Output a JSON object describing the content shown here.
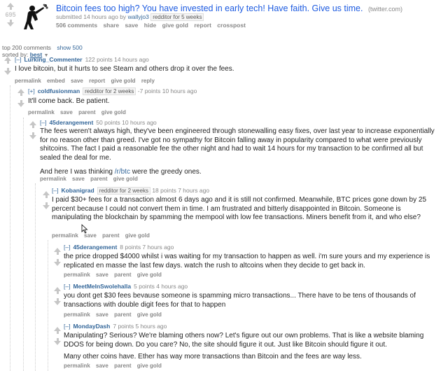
{
  "post": {
    "score": "695",
    "title": "Bitcoin fees too high? You have invested in early tech! Have faith. Give us time.",
    "domain": "(twitter.com)",
    "submitted_prefix": "submitted 14 hours ago by",
    "author": "wallyjo3",
    "flair": "redditor for 5 weeks",
    "buttons": [
      "506 comments",
      "share",
      "save",
      "hide",
      "give gold",
      "report",
      "crosspost"
    ]
  },
  "comments_info": {
    "count_text": "top 200 comments",
    "show_all": "show 500",
    "sorted_by": "sorted by:",
    "sort": "best"
  },
  "comments": [
    {
      "toggle": "[–]",
      "author": "Lurking_Commenter",
      "meta": "122 points 14 hours ago",
      "flair": "",
      "body": [
        "I love bitcoin, but it hurts to see Steam and others drop it over the fees."
      ],
      "buttons": [
        "permalink",
        "embed",
        "save",
        "report",
        "give gold",
        "reply"
      ]
    },
    {
      "toggle": "[+]",
      "author": "coldfusionman",
      "flair": "redditor for 2 weeks",
      "meta": "-7 points 10 hours ago",
      "body": [
        "It'll come back. Be patient."
      ],
      "buttons": [
        "permalink",
        "save",
        "parent",
        "give gold"
      ]
    },
    {
      "toggle": "[–]",
      "author": "45derangement",
      "meta": "50 points 10 hours ago",
      "flair": "",
      "body": [
        "The fees weren't always high, they've been engineered through stonewalling easy fixes, over last year to increase exponentially for no reason other than greed. I've got no sympathy for Bitcoin falling away in popularity compared to what were previously shitcoins. The fact I paid a reasonable fee the other night and had to wait 14 hours for my transaction to be confirmed all but sealed the deal for me.",
        "And here I was thinking "
      ],
      "link": "/r/btc",
      "link_suffix": " were the greedy ones.",
      "buttons": [
        "permalink",
        "save",
        "parent",
        "give gold"
      ]
    },
    {
      "toggle": "[–]",
      "author": "Kobanigrad",
      "flair": "redditor for 2 weeks",
      "meta": "18 points 7 hours ago",
      "body": [
        "I paid $30+ fees for a transaction almost 6 days ago and it is still not confirmed. Meanwhile, BTC prices gone down by 25 percent because I could not convert them in time. I am frustrated and bitterly disappointed in Bitcoin. Someone is manipulating the blockchain by spamming the mempool with low fee transactions. Miners benefit from it, and who else?"
      ],
      "buttons": [
        "permalink",
        "save",
        "parent",
        "give gold"
      ]
    },
    {
      "toggle": "[–]",
      "author": "45derangement",
      "meta": "8 points 7 hours ago",
      "flair": "",
      "body": [
        "the price dropped $4000 whilst i was waiting for my transaction to happen as well. i'm sure yours and my experience is replicated en masse the last few days. watch the rush to altcoins when they decide to get back in."
      ],
      "buttons": [
        "permalink",
        "save",
        "parent",
        "give gold"
      ]
    },
    {
      "toggle": "[–]",
      "author": "MeetMeInSwolehalla",
      "meta": "5 points 4 hours ago",
      "flair": "",
      "body": [
        "you dont get $30 fees bevause someone is spamming micro transactions... There have to be tens of thousands of transactions with double digit fees for that to happen"
      ],
      "buttons": [
        "permalink",
        "save",
        "parent",
        "give gold"
      ]
    },
    {
      "toggle": "[–]",
      "author": "MondayDash",
      "meta": "7 points 5 hours ago",
      "flair": "",
      "body": [
        "Manipulating? Serious? We're blaming others now? Let's figure out our own problems. That is like a website blaming DDOS for being down. Do you care? No, the site should figure it out. Just like Bitcoin should figure it out.",
        "Many other coins have. Ether has way more transactions than Bitcoin and the fees are way less."
      ],
      "buttons": [
        "permalink",
        "save",
        "parent",
        "give gold"
      ]
    }
  ]
}
